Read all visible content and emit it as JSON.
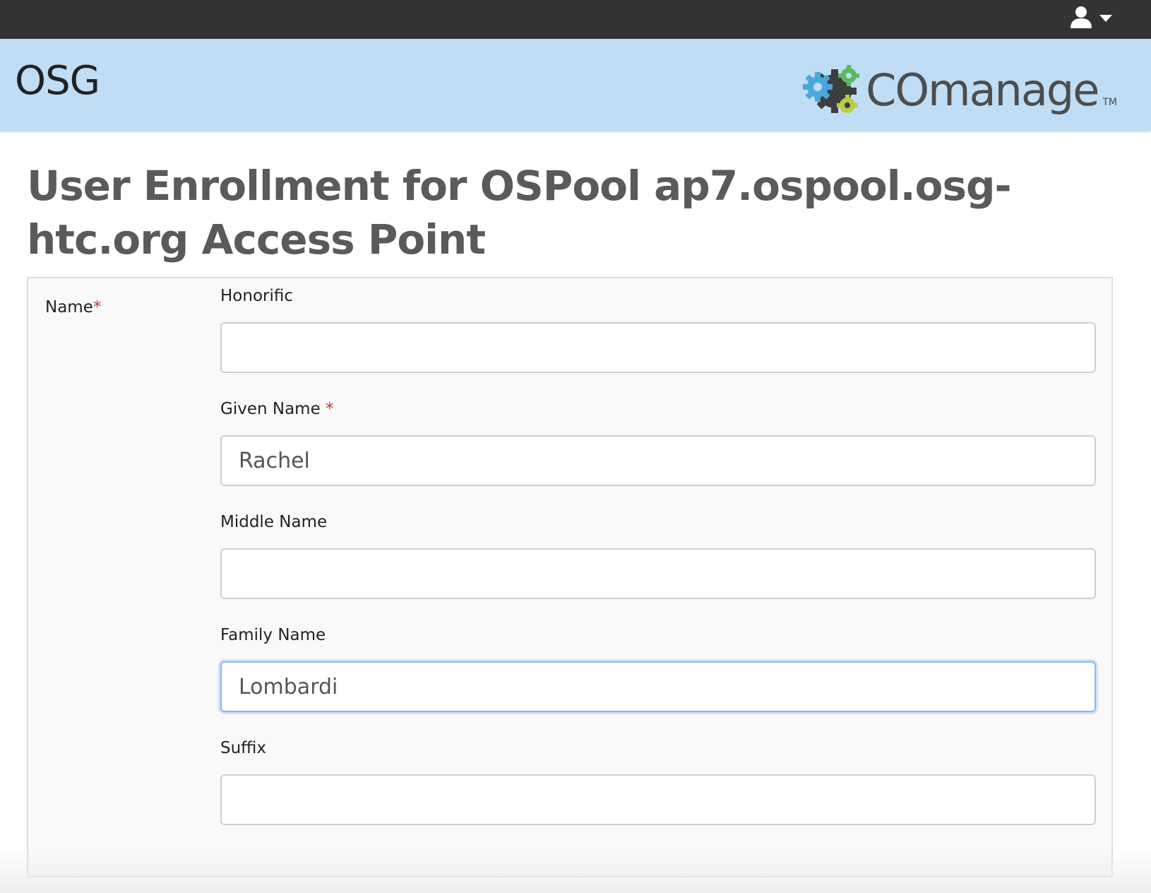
{
  "topbar": {
    "user_icon": "user-icon",
    "dropdown_icon": "caret-down-icon",
    "background_color": "#333333"
  },
  "header": {
    "title": "OSG",
    "logo_text": "COmanage",
    "logo_tm": "TM",
    "logo_icon": "gears-icon",
    "background_color": "#bfddf4"
  },
  "page": {
    "title": "User Enrollment for OSPool ap7.ospool.osg-htc.org Access Point"
  },
  "form": {
    "group_label": "Name",
    "required_mark": "*",
    "fields": [
      {
        "label": "Honorific",
        "required": false,
        "value": "",
        "placeholder": ""
      },
      {
        "label": "Given Name",
        "required": true,
        "value": "Rachel",
        "placeholder": ""
      },
      {
        "label": "Middle Name",
        "required": false,
        "value": "",
        "placeholder": ""
      },
      {
        "label": "Family Name",
        "required": false,
        "value": "Lombardi",
        "placeholder": "",
        "focused": true
      },
      {
        "label": "Suffix",
        "required": false,
        "value": "",
        "placeholder": ""
      }
    ]
  },
  "colors": {
    "required": "#c0392b",
    "title_text": "#5a5a5a",
    "focus_border": "#8bb8ec"
  }
}
